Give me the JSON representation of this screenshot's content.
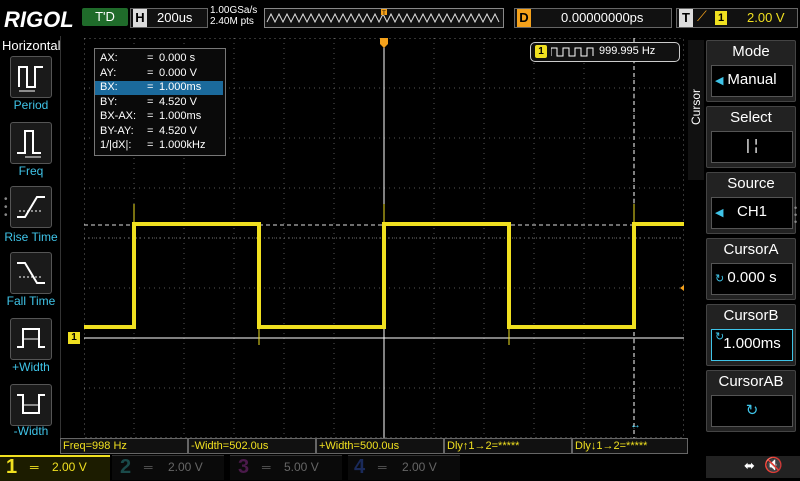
{
  "brand": "RIGOL",
  "top": {
    "trigger_status": "T'D",
    "horizontal_label": "H",
    "timebase": "200us",
    "sample_rate": "1.00GSa/s",
    "memory_points": "2.40M pts",
    "delay_label": "D",
    "delay_value": "0.00000000ps",
    "trigger_label": "T",
    "trigger_source": "1",
    "trigger_level": "2.00 V",
    "trigger_marker": "T"
  },
  "left_menu": {
    "title": "Horizontal",
    "items": [
      {
        "label": "Period",
        "icon": "period-icon"
      },
      {
        "label": "Freq",
        "icon": "freq-icon"
      },
      {
        "label": "Rise Time",
        "icon": "rise-time-icon"
      },
      {
        "label": "Fall Time",
        "icon": "fall-time-icon"
      },
      {
        "label": "+Width",
        "icon": "positive-width-icon"
      },
      {
        "label": "-Width",
        "icon": "negative-width-icon"
      }
    ]
  },
  "cursor_table": [
    {
      "key": "AX:",
      "eq": "=",
      "value": "0.000 s"
    },
    {
      "key": "AY:",
      "eq": "=",
      "value": "0.000 V"
    },
    {
      "key": "BX:",
      "eq": "=",
      "value": "1.000ms",
      "selected": true
    },
    {
      "key": "BY:",
      "eq": "=",
      "value": "4.520 V"
    },
    {
      "key": "BX-AX:",
      "eq": "=",
      "value": "1.000ms"
    },
    {
      "key": "BY-AY:",
      "eq": "=",
      "value": "4.520 V"
    },
    {
      "key": "1/|dX|:",
      "eq": "=",
      "value": "1.000kHz"
    }
  ],
  "freq_counter": {
    "channel": "1",
    "value": "999.995 Hz"
  },
  "right_menu": {
    "tab": "Cursor",
    "items": [
      {
        "title": "Mode",
        "value": "Manual"
      },
      {
        "title": "Select",
        "value": "|    ¦"
      },
      {
        "title": "Source",
        "value": "CH1"
      },
      {
        "title": "CursorA",
        "value": "0.000 s"
      },
      {
        "title": "CursorB",
        "value": "1.000ms"
      },
      {
        "title": "CursorAB",
        "value": ""
      }
    ]
  },
  "measurements": [
    "Freq=998 Hz",
    "-Width=502.0us",
    "+Width=500.0us",
    "Dly↑1→2=*****",
    "Dly↓1→2=*****"
  ],
  "channels": [
    {
      "num": "1",
      "value": "2.00 V",
      "color": "#f0e020",
      "active": true
    },
    {
      "num": "2",
      "value": "2.00 V",
      "color": "#1ec8c8",
      "active": false
    },
    {
      "num": "3",
      "value": "5.00 V",
      "color": "#e040e0",
      "active": false
    },
    {
      "num": "4",
      "value": "2.00 V",
      "color": "#3a6cff",
      "active": false
    }
  ],
  "ch1_marker": "1",
  "waveform": {
    "type": "square",
    "frequency_hz": 999.995,
    "amplitude_v": 4.52,
    "trace_color": "#f0e020"
  },
  "colors": {
    "accent": "#3fc4e8",
    "trigger": "#f4a11b",
    "ch1": "#f0e020"
  }
}
